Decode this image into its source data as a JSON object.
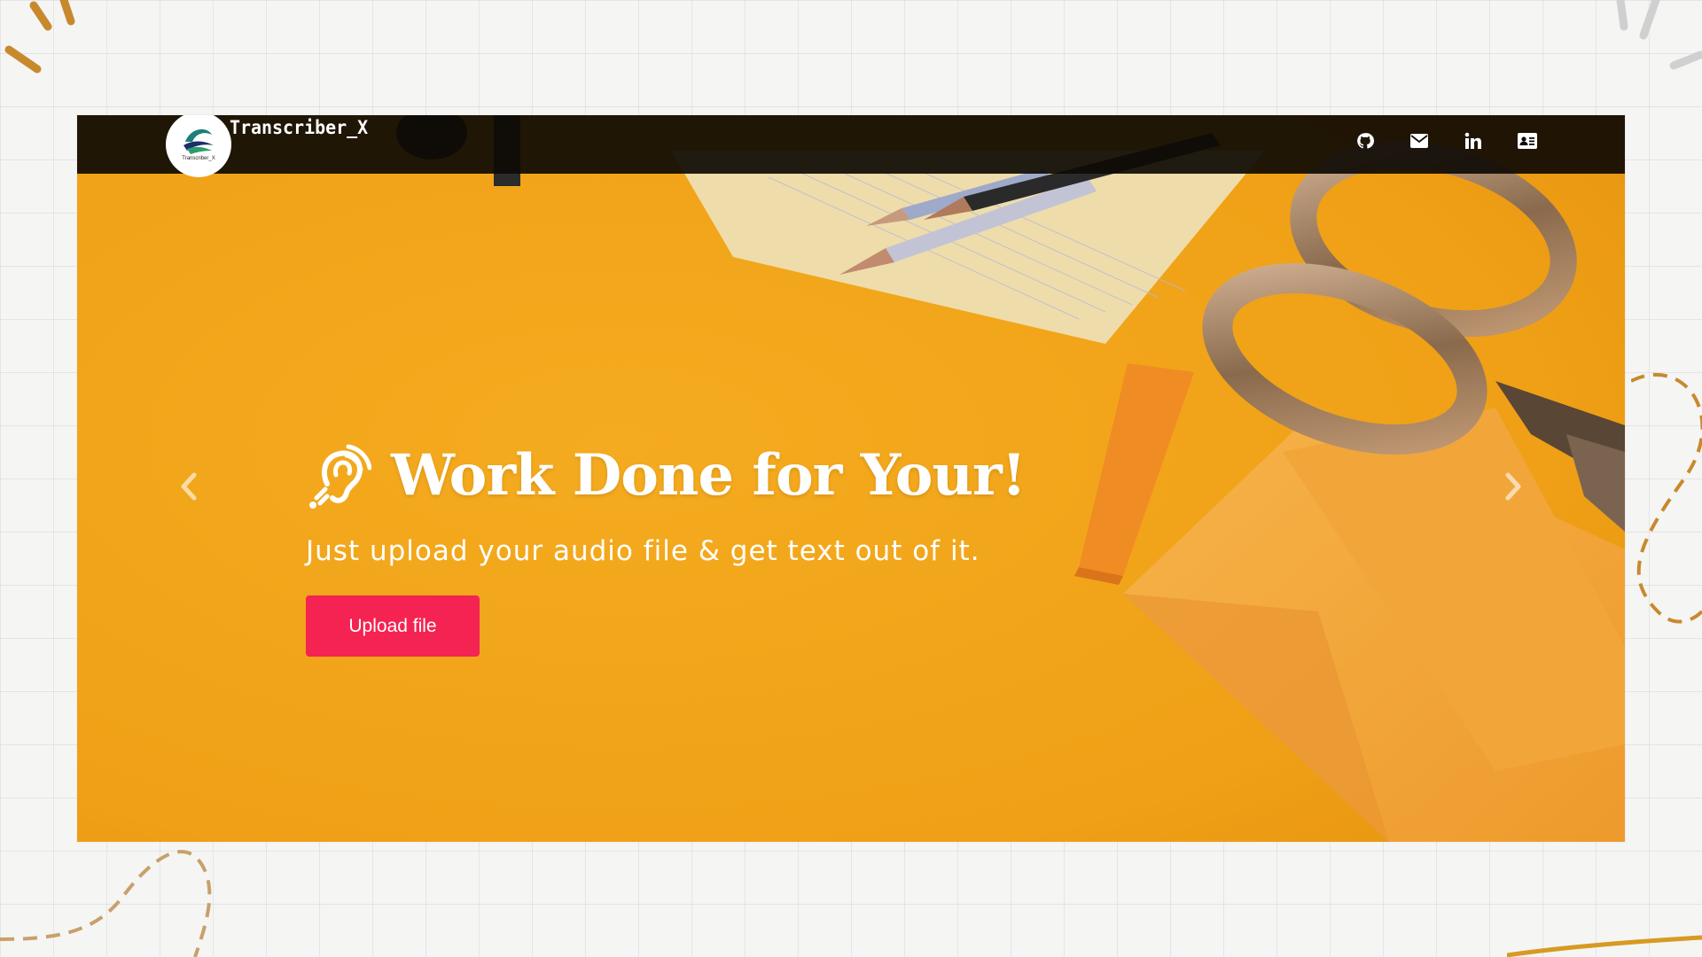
{
  "brand": {
    "name": "Transcriber_X",
    "logo_caption": "Transcriber_X"
  },
  "nav_icons": [
    {
      "name": "github-icon"
    },
    {
      "name": "envelope-icon"
    },
    {
      "name": "linkedin-icon"
    },
    {
      "name": "contact-card-icon"
    }
  ],
  "hero": {
    "headline": "Work Done for Your!",
    "subtitle": "Just upload your audio file & get text out of it.",
    "upload_label": "Upload file",
    "headline_icon": "ear-icon"
  },
  "carousel": {
    "prev_icon": "chevron-left-icon",
    "next_icon": "chevron-right-icon"
  },
  "colors": {
    "accent_button": "#f42352",
    "hero_background": "#f2a51d",
    "navbar": "#0e0a04",
    "doodle": "#c8892d"
  }
}
